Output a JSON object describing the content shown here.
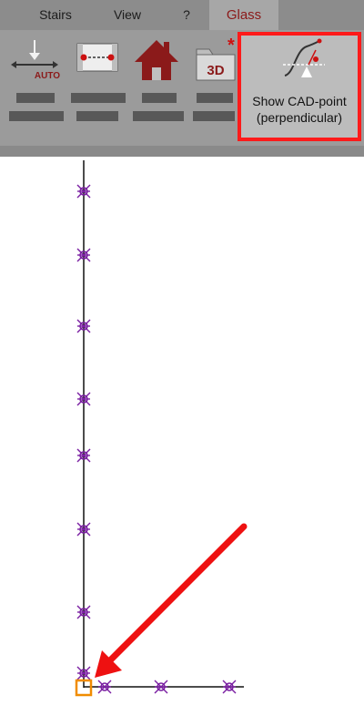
{
  "tabs": [
    {
      "label": "Stairs",
      "active": false
    },
    {
      "label": "View",
      "active": false
    },
    {
      "label": "?",
      "active": false
    },
    {
      "label": "Glass",
      "active": true
    }
  ],
  "toolbar": {
    "auto_icon_text": "AUTO",
    "threed_icon_text": "3D",
    "asterisk": "*",
    "cad_button_line1": "Show CAD-point",
    "cad_button_line2": "(perpendicular)"
  },
  "colors": {
    "highlight": "#ff1a1a",
    "cad_point": "#7a1fa2",
    "selected_corner": "#f08c00",
    "active_tab": "#8b1a1a",
    "house": "#8b1a1a",
    "annotation_arrow": "#ee1111"
  },
  "icons": [
    "auto-height-icon",
    "wall-points-icon",
    "house-icon",
    "3d-folder-icon",
    "cad-point-perpendicular-icon"
  ]
}
